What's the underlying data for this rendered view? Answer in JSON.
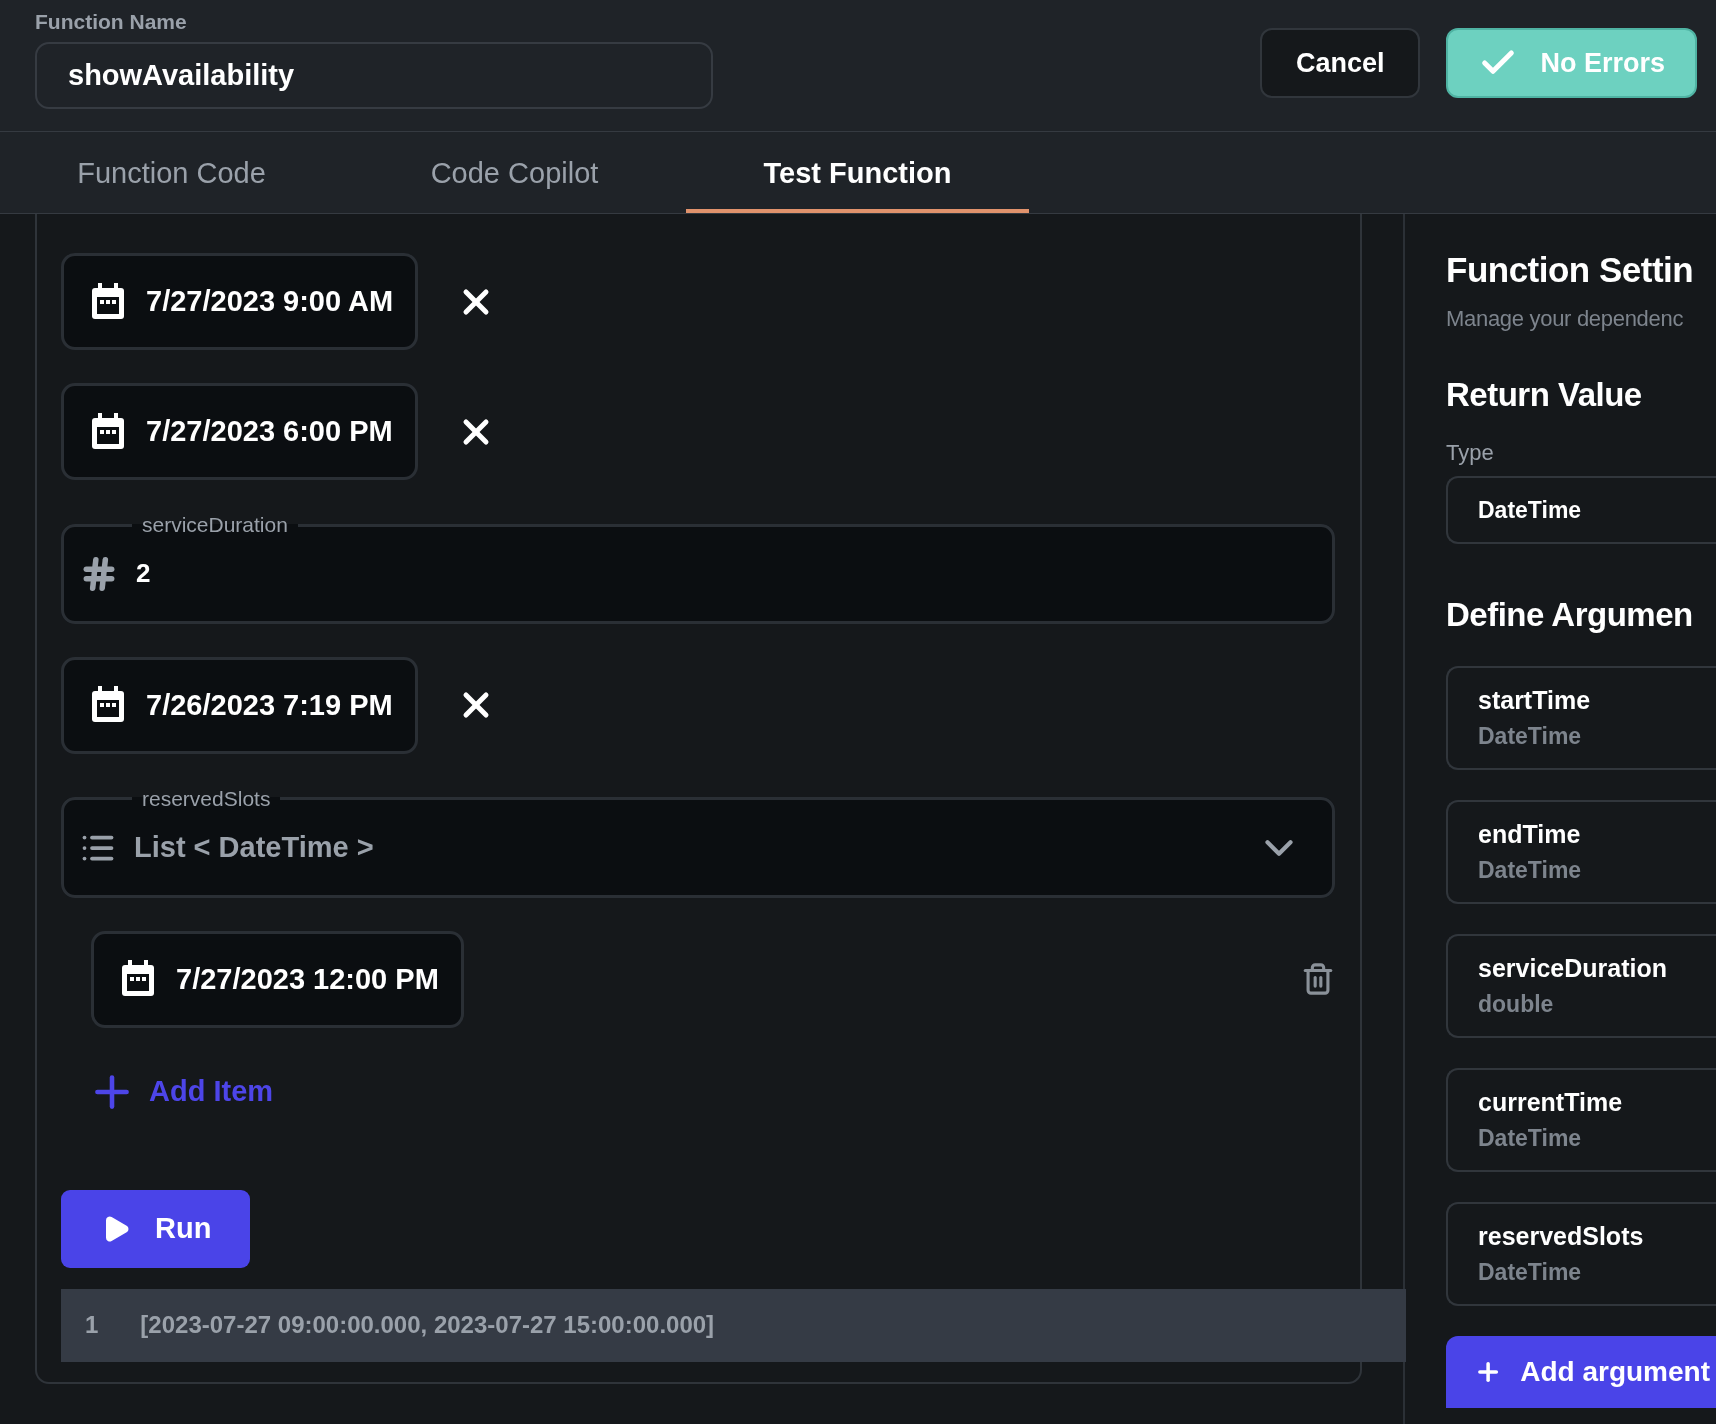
{
  "function_name": {
    "label": "Function Name",
    "value": "showAvailability"
  },
  "header_buttons": {
    "cancel": "Cancel",
    "status": "No Errors"
  },
  "tabs": [
    {
      "label": "Function Code",
      "selected": false
    },
    {
      "label": "Code Copilot",
      "selected": false
    },
    {
      "label": "Test Function",
      "selected": true
    }
  ],
  "test_inputs": [
    {
      "kind": "datetime",
      "value": "7/27/2023 9:00 AM"
    },
    {
      "kind": "datetime",
      "value": "7/27/2023 6:00 PM"
    },
    {
      "kind": "number",
      "label": "serviceDuration",
      "value": "2"
    },
    {
      "kind": "datetime",
      "value": "7/26/2023 7:19 PM"
    },
    {
      "kind": "list",
      "label": "reservedSlots",
      "type": "List < DateTime >",
      "expanded": true,
      "items": [
        {
          "value": "7/27/2023 12:00 PM"
        }
      ],
      "add_label": "Add Item"
    }
  ],
  "run_button": "Run",
  "output": {
    "line": "1",
    "text": "[2023-07-27 09:00:00.000, 2023-07-27 15:00:00.000]"
  },
  "settings": {
    "title": "Function Settin",
    "subtitle": "Manage your dependenc",
    "return_value": {
      "heading": "Return Value",
      "type_label": "Type",
      "type_value": "DateTime"
    },
    "arguments": {
      "heading": "Define Argumen",
      "items": [
        {
          "name": "startTime",
          "type": "DateTime"
        },
        {
          "name": "endTime",
          "type": "DateTime"
        },
        {
          "name": "serviceDuration",
          "type": "double"
        },
        {
          "name": "currentTime",
          "type": "DateTime"
        },
        {
          "name": "reservedSlots",
          "type": "DateTime"
        }
      ]
    },
    "add_button": "Add argument"
  }
}
